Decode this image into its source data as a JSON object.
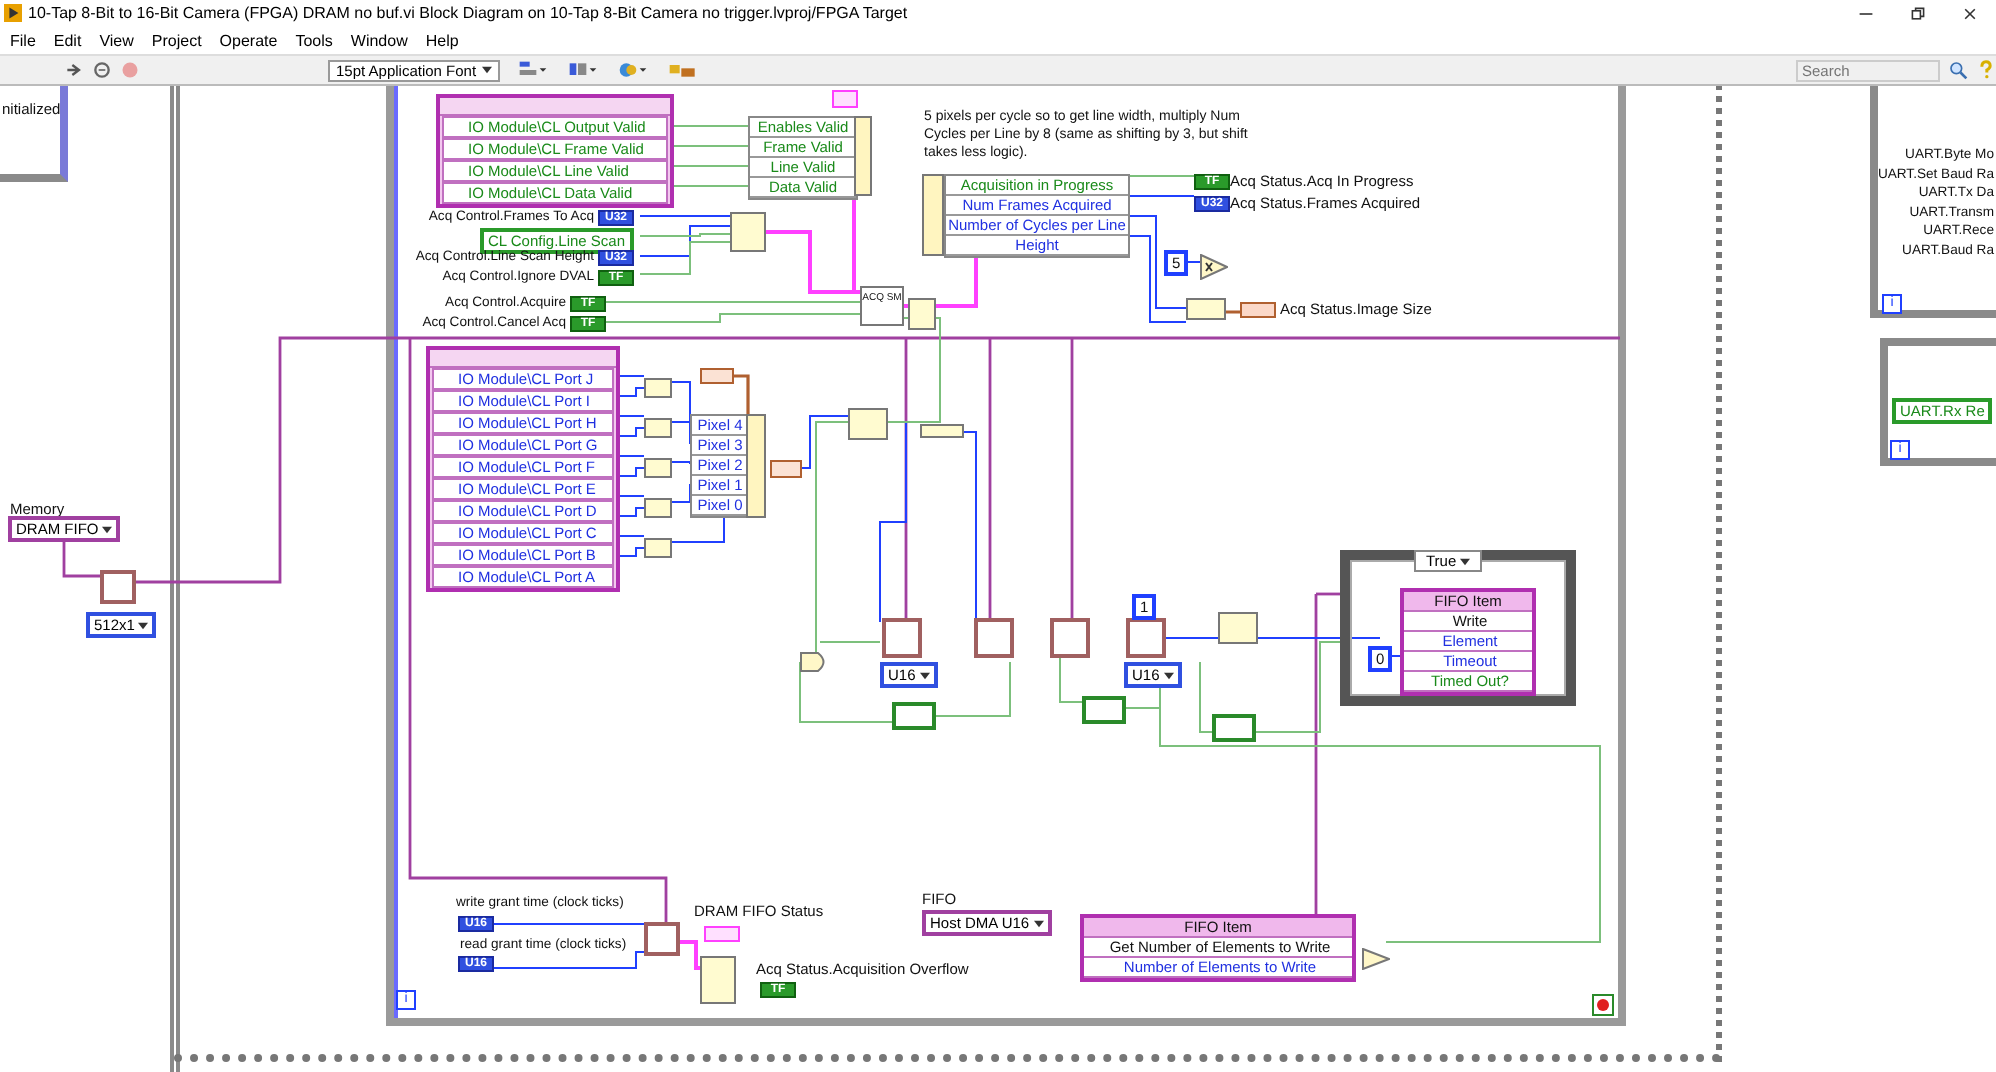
{
  "window": {
    "title": "10-Tap 8-Bit to 16-Bit Camera (FPGA) DRAM no buf.vi Block Diagram on 10-Tap 8-Bit Camera no trigger.lvproj/FPGA Target"
  },
  "menu": [
    "File",
    "Edit",
    "View",
    "Project",
    "Operate",
    "Tools",
    "Window",
    "Help"
  ],
  "toolbar": {
    "font": "15pt Application Font",
    "search": {
      "placeholder": "Search"
    }
  },
  "left": {
    "frame_text": "nitialized",
    "memory_label": "Memory",
    "memory": "DRAM FIFO",
    "size": "512x1"
  },
  "valid_node": [
    "IO Module\\CL Output Valid",
    "IO Module\\CL Frame Valid",
    "IO Module\\CL Line Valid",
    "IO Module\\CL Data Valid"
  ],
  "valid_bundle": [
    "Enables Valid",
    "Frame Valid",
    "Line Valid",
    "Data Valid"
  ],
  "acq_controls": [
    {
      "label": "Acq Control.Frames To Acq",
      "kind": "integer",
      "type": "U32"
    },
    {
      "label": "CL Config.Line Scan",
      "kind": "local"
    },
    {
      "label": "Acq Control.Line Scan Height",
      "kind": "integer",
      "type": "U32"
    },
    {
      "label": "Acq Control.Ignore DVAL",
      "kind": "boolean",
      "type": "TF"
    },
    {
      "label": "Acq Control.Acquire",
      "kind": "boolean",
      "type": "TF"
    },
    {
      "label": "Acq Control.Cancel Acq",
      "kind": "boolean",
      "type": "TF"
    }
  ],
  "acq_sm": "ACQ SM",
  "comment": "5  pixels per cycle so to get line width, multiply Num Cycles per Line by 8 (same as shifting by 3, but shift takes less logic).",
  "status_unbundle": [
    "Acquisition in Progress",
    "Num Frames Acquired",
    "Number of Cycles per Line",
    "Height"
  ],
  "status_outputs": [
    {
      "label": "Acq Status.Acq In Progress",
      "kind": "boolean",
      "type": "TF"
    },
    {
      "label": "Acq Status.Frames Acquired",
      "kind": "integer",
      "type": "U32"
    },
    {
      "label": "Acq Status.Image Size",
      "kind": "wide"
    }
  ],
  "multiplier_constant": "5",
  "ports": [
    "IO Module\\CL Port J",
    "IO Module\\CL Port I",
    "IO Module\\CL Port H",
    "IO Module\\CL Port G",
    "IO Module\\CL Port F",
    "IO Module\\CL Port E",
    "IO Module\\CL Port D",
    "IO Module\\CL Port C",
    "IO Module\\CL Port B",
    "IO Module\\CL Port A"
  ],
  "pixels": [
    "Pixel 4",
    "Pixel 3",
    "Pixel 2",
    "Pixel 1",
    "Pixel 0"
  ],
  "fifo": {
    "types": [
      "U16",
      "U16"
    ],
    "constant": "1"
  },
  "case": {
    "selector": "True",
    "timeout_constant": "0",
    "node": {
      "title": "FIFO Item",
      "rows": [
        {
          "label": "Write",
          "kind": "method"
        },
        {
          "label": "Element",
          "kind": "numeric"
        },
        {
          "label": "Timeout",
          "kind": "numeric"
        },
        {
          "label": "Timed Out?",
          "kind": "boolean"
        }
      ]
    }
  },
  "grant": [
    {
      "label": "write grant time (clock ticks)",
      "type": "U16"
    },
    {
      "label": "read grant time (clock ticks)",
      "type": "U16"
    }
  ],
  "dram_status": "DRAM FIFO Status",
  "overflow": {
    "label": "Acq Status.Acquisition Overflow",
    "type": "TF"
  },
  "host_fifo": {
    "label": "FIFO",
    "value": "Host DMA U16",
    "node_title": "FIFO Item",
    "rows": [
      {
        "label": "Get Number of Elements to Write",
        "kind": "method"
      },
      {
        "label": "Number of Elements to Write",
        "kind": "numeric"
      }
    ]
  },
  "uart": [
    "UART.Byte Mo",
    "UART.Set Baud Ra",
    "UART.Tx Da",
    "UART.Transm",
    "UART.Rece",
    "UART.Baud Ra"
  ],
  "uart_rx": "UART.Rx Re",
  "loop_indices": [
    "i",
    "i",
    "i"
  ]
}
